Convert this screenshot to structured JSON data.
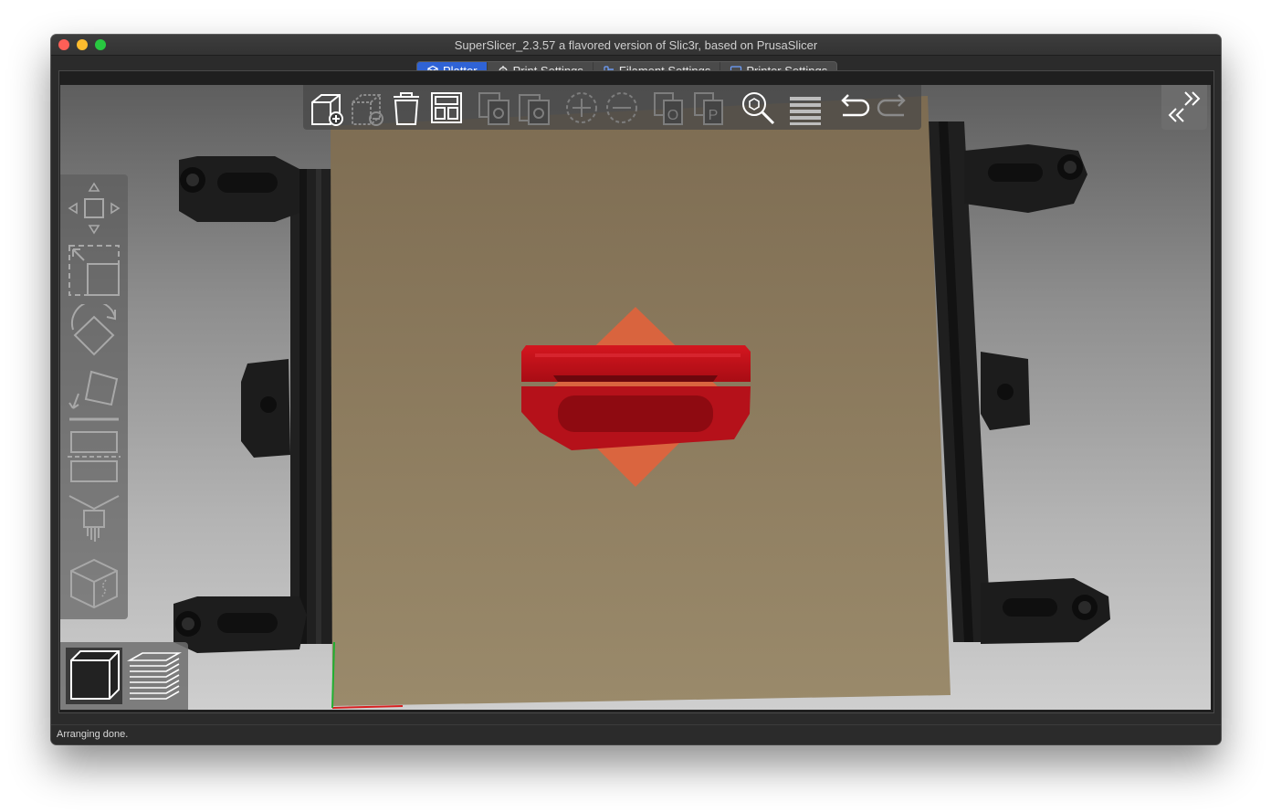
{
  "window": {
    "title": "SuperSlicer_2.3.57 a flavored version of Slic3r, based on PrusaSlicer"
  },
  "tabs": [
    {
      "label": "Platter",
      "icon": "cube-icon",
      "active": true
    },
    {
      "label": "Print Settings",
      "icon": "gear-icon",
      "active": false
    },
    {
      "label": "Filament Settings",
      "icon": "spool-icon",
      "active": false
    },
    {
      "label": "Printer Settings",
      "icon": "printer-icon",
      "active": false
    }
  ],
  "toolbar": {
    "buttons": [
      {
        "name": "add",
        "icon": "add-object-icon",
        "enabled": true
      },
      {
        "name": "delete",
        "icon": "delete-object-icon",
        "enabled": false
      },
      {
        "name": "delete-all",
        "icon": "trash-icon",
        "enabled": true
      },
      {
        "name": "arrange",
        "icon": "arrange-icon",
        "enabled": true
      },
      {
        "name": "copy",
        "icon": "copy-icon",
        "enabled": false
      },
      {
        "name": "paste",
        "icon": "paste-icon",
        "enabled": false
      },
      {
        "name": "add-instance",
        "icon": "plus-circle-icon",
        "enabled": false
      },
      {
        "name": "remove-instance",
        "icon": "minus-circle-icon",
        "enabled": false
      },
      {
        "name": "split-objects",
        "icon": "split-objects-icon",
        "enabled": false
      },
      {
        "name": "split-parts",
        "icon": "split-parts-icon",
        "enabled": false
      },
      {
        "name": "search",
        "icon": "search-icon",
        "enabled": true
      },
      {
        "name": "layers-editing",
        "icon": "layers-icon",
        "enabled": true
      },
      {
        "name": "undo",
        "icon": "undo-icon",
        "enabled": true
      },
      {
        "name": "redo",
        "icon": "redo-icon",
        "enabled": false
      }
    ]
  },
  "gizmos": [
    {
      "name": "move",
      "icon": "move-icon"
    },
    {
      "name": "scale",
      "icon": "scale-icon"
    },
    {
      "name": "rotate",
      "icon": "rotate-icon"
    },
    {
      "name": "place-on-face",
      "icon": "place-on-face-icon"
    },
    {
      "name": "cut",
      "icon": "cut-icon"
    },
    {
      "name": "paint",
      "icon": "paint-brush-icon"
    },
    {
      "name": "seam",
      "icon": "seam-cube-icon"
    }
  ],
  "view_toggle": {
    "active": "3d",
    "buttons": [
      {
        "name": "3d",
        "icon": "3d-view-cube-icon"
      },
      {
        "name": "preview",
        "icon": "layers-preview-icon"
      }
    ]
  },
  "colors": {
    "accent": "#2f63d6",
    "object": "#c8141c",
    "bed": "#8a7a5e",
    "selection": "#e8603a"
  },
  "status": {
    "text": "Arranging done."
  }
}
